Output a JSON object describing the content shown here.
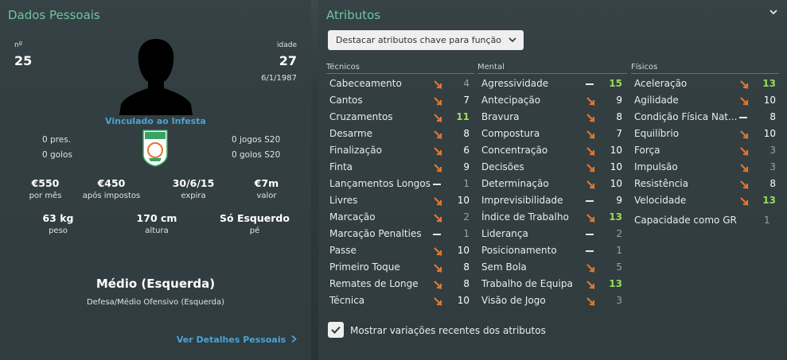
{
  "personal": {
    "title": "Dados Pessoais",
    "number_label": "nº",
    "number": "25",
    "age_label": "idade",
    "age": "27",
    "dob": "6/1/1987",
    "club_status": "Vinculado ao Infesta",
    "pres_left": "0 pres.",
    "goals_left": "0 golos",
    "games_right": "0 jogos S20",
    "goals_right": "0 golos S20",
    "money": [
      {
        "value": "€550",
        "label": "por mês"
      },
      {
        "value": "€450",
        "label": "após impostos"
      },
      {
        "value": "30/6/15",
        "label": "expira"
      },
      {
        "value": "€7m",
        "label": "valor"
      }
    ],
    "physical": [
      {
        "value": "63 kg",
        "label": "peso"
      },
      {
        "value": "170 cm",
        "label": "altura"
      },
      {
        "value": "Só Esquerdo",
        "label": "pé"
      }
    ],
    "position_main": "Médio (Esquerda)",
    "position_sub": "Defesa/Médio Ofensivo (Esquerda)",
    "details_link": "Ver Detalhes Pessoais"
  },
  "attributes": {
    "title": "Atributos",
    "dropdown_label": "Destacar atributos chave para função",
    "columns": [
      {
        "heading": "Técnicos",
        "items": [
          {
            "name": "Cabeceamento",
            "trend": "arrow",
            "value": "4",
            "color": "grey"
          },
          {
            "name": "Cantos",
            "trend": "arrow",
            "value": "7",
            "color": "white"
          },
          {
            "name": "Cruzamentos",
            "trend": "arrow",
            "value": "11",
            "color": "green"
          },
          {
            "name": "Desarme",
            "trend": "arrow",
            "value": "8",
            "color": "white"
          },
          {
            "name": "Finalização",
            "trend": "arrow",
            "value": "6",
            "color": "white"
          },
          {
            "name": "Finta",
            "trend": "arrow",
            "value": "9",
            "color": "white"
          },
          {
            "name": "Lançamentos Longos",
            "trend": "dash",
            "value": "1",
            "color": "grey"
          },
          {
            "name": "Livres",
            "trend": "arrow",
            "value": "10",
            "color": "white"
          },
          {
            "name": "Marcação",
            "trend": "arrow",
            "value": "2",
            "color": "grey"
          },
          {
            "name": "Marcação Penalties",
            "trend": "dash",
            "value": "1",
            "color": "grey"
          },
          {
            "name": "Passe",
            "trend": "arrow",
            "value": "10",
            "color": "white"
          },
          {
            "name": "Primeiro Toque",
            "trend": "arrow",
            "value": "8",
            "color": "white"
          },
          {
            "name": "Remates de Longe",
            "trend": "arrow",
            "value": "8",
            "color": "white"
          },
          {
            "name": "Técnica",
            "trend": "arrow",
            "value": "10",
            "color": "white"
          }
        ]
      },
      {
        "heading": "Mental",
        "items": [
          {
            "name": "Agressividade",
            "trend": "dash",
            "value": "15",
            "color": "green"
          },
          {
            "name": "Antecipação",
            "trend": "arrow",
            "value": "9",
            "color": "white"
          },
          {
            "name": "Bravura",
            "trend": "arrow",
            "value": "8",
            "color": "white"
          },
          {
            "name": "Compostura",
            "trend": "arrow",
            "value": "7",
            "color": "white"
          },
          {
            "name": "Concentração",
            "trend": "arrow",
            "value": "10",
            "color": "white"
          },
          {
            "name": "Decisões",
            "trend": "arrow",
            "value": "10",
            "color": "white"
          },
          {
            "name": "Determinação",
            "trend": "arrow",
            "value": "10",
            "color": "white"
          },
          {
            "name": "Imprevisibilidade",
            "trend": "dash",
            "value": "9",
            "color": "white"
          },
          {
            "name": "Índice de Trabalho",
            "trend": "arrow",
            "value": "13",
            "color": "green"
          },
          {
            "name": "Liderança",
            "trend": "dash",
            "value": "2",
            "color": "grey"
          },
          {
            "name": "Posicionamento",
            "trend": "dash",
            "value": "1",
            "color": "grey"
          },
          {
            "name": "Sem Bola",
            "trend": "arrow",
            "value": "5",
            "color": "grey"
          },
          {
            "name": "Trabalho de Equipa",
            "trend": "arrow",
            "value": "13",
            "color": "green"
          },
          {
            "name": "Visão de Jogo",
            "trend": "arrow",
            "value": "3",
            "color": "grey"
          }
        ]
      },
      {
        "heading": "Físicos",
        "items": [
          {
            "name": "Aceleração",
            "trend": "arrow",
            "value": "13",
            "color": "green"
          },
          {
            "name": "Agilidade",
            "trend": "arrow",
            "value": "10",
            "color": "white"
          },
          {
            "name": "Condição Física Nat...",
            "trend": "dash",
            "value": "8",
            "color": "white"
          },
          {
            "name": "Equilíbrio",
            "trend": "arrow",
            "value": "10",
            "color": "white"
          },
          {
            "name": "Força",
            "trend": "arrow",
            "value": "3",
            "color": "grey"
          },
          {
            "name": "Impulsão",
            "trend": "arrow",
            "value": "3",
            "color": "grey"
          },
          {
            "name": "Resistência",
            "trend": "arrow",
            "value": "8",
            "color": "white"
          },
          {
            "name": "Velocidade",
            "trend": "arrow",
            "value": "13",
            "color": "green"
          }
        ]
      }
    ],
    "gk_label": "Capacidade como GR",
    "gk_value": "1",
    "show_changes_label": "Mostrar variações recentes dos atributos"
  },
  "colors": {
    "accent_title": "#6fc4a3",
    "link": "#4aa3d6",
    "trend_arrow": "#e0762f",
    "value_green": "#9bdb5a",
    "value_grey": "#9aa3a4"
  }
}
